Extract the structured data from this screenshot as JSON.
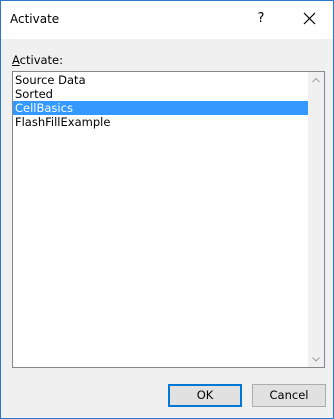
{
  "window": {
    "title": "Activate",
    "help_label": "?",
    "close_icon": "close-icon"
  },
  "form": {
    "label_accesskey": "A",
    "label_rest": "ctivate:"
  },
  "list": {
    "items": [
      {
        "label": "Source Data",
        "selected": false
      },
      {
        "label": "Sorted",
        "selected": false
      },
      {
        "label": "CellBasics",
        "selected": true
      },
      {
        "label": "FlashFillExample",
        "selected": false
      }
    ],
    "selection_color": "#3399ff"
  },
  "buttons": {
    "ok_label": "OK",
    "cancel_label": "Cancel"
  },
  "colors": {
    "window_border": "#2b78c9",
    "dialog_background": "#f0f0f0",
    "default_button_border": "#0078d7"
  }
}
